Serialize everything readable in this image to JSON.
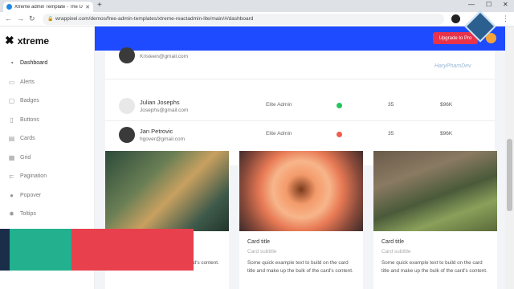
{
  "browser": {
    "tab_title": "Xtreme admin Template - The U...",
    "url": "wrappixel.com/demos/free-admin-templates/xtreme-reactadmin-lite/main/#/dashboard"
  },
  "sidebar": {
    "brand": "xtreme",
    "items": [
      {
        "label": "Dashboard",
        "icon": "dashboard-icon",
        "active": true
      },
      {
        "label": "Alerts",
        "icon": "chat-icon"
      },
      {
        "label": "Badges",
        "icon": "badge-icon"
      },
      {
        "label": "Buttons",
        "icon": "cursor-icon"
      },
      {
        "label": "Cards",
        "icon": "cards-icon"
      },
      {
        "label": "Grid",
        "icon": "grid-icon"
      },
      {
        "label": "Pagination",
        "icon": "pagination-icon"
      },
      {
        "label": "Popover",
        "icon": "popover-icon"
      },
      {
        "label": "Toltips",
        "icon": "gear-icon"
      }
    ]
  },
  "topbar": {
    "upgrade_label": "Upgrade to Pro"
  },
  "watermark": "HaryPhamDev",
  "users": [
    {
      "name": "",
      "email": "Kristeen@gmail.com",
      "role": "",
      "status_color": "",
      "count": "",
      "amount": ""
    },
    {
      "name": "Julian Josephs",
      "email": "Josephs@gmail.com",
      "role": "Elite Admin",
      "status_color": "#22c55e",
      "count": "35",
      "amount": "$96K"
    },
    {
      "name": "Jan Petrovic",
      "email": "hgover@gmail.com",
      "role": "Elite Admin",
      "status_color": "#f25c4a",
      "count": "35",
      "amount": "$96K"
    }
  ],
  "cards": [
    {
      "title": "",
      "subtitle": "",
      "text": "title and make up the bulk of the card's content.",
      "image": "crab-photo"
    },
    {
      "title": "Card title",
      "subtitle": "Card subtitle",
      "text": "Some quick example text to build on the card title and make up the bulk of the card's content.",
      "image": "rose-photo"
    },
    {
      "title": "Card title",
      "subtitle": "Card subtitle",
      "text": "Some quick example text to build on the card title and make up the bulk of the card's content.",
      "image": "puffin-photo"
    }
  ],
  "colors": {
    "primary": "#1e4bff",
    "upgrade": "#e8334a",
    "overlay_teal": "#22b08f",
    "overlay_red": "#e8404d"
  }
}
